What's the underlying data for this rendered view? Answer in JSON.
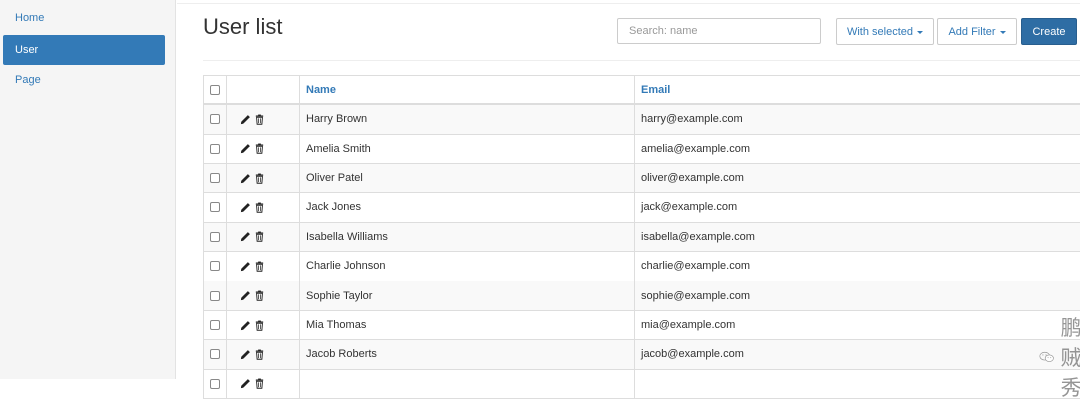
{
  "sidebar": {
    "items": [
      {
        "label": "Home",
        "active": false
      },
      {
        "label": "User",
        "active": true
      },
      {
        "label": "Page",
        "active": false
      }
    ]
  },
  "header": {
    "title": "User list",
    "search_placeholder": "Search: name",
    "with_selected_label": "With selected",
    "add_filter_label": "Add Filter",
    "create_label": "Create"
  },
  "table": {
    "columns": [
      "Name",
      "Email"
    ],
    "rows": [
      {
        "name": "Harry Brown",
        "email": "harry@example.com"
      },
      {
        "name": "Amelia Smith",
        "email": "amelia@example.com"
      },
      {
        "name": "Oliver Patel",
        "email": "oliver@example.com"
      },
      {
        "name": "Jack Jones",
        "email": "jack@example.com"
      },
      {
        "name": "Isabella Williams",
        "email": "isabella@example.com"
      },
      {
        "name": "Charlie Johnson",
        "email": "charlie@example.com"
      },
      {
        "name": "Sophie Taylor",
        "email": "sophie@example.com"
      },
      {
        "name": "Mia Thomas",
        "email": "mia@example.com"
      },
      {
        "name": "Jacob Roberts",
        "email": "jacob@example.com"
      }
    ]
  },
  "watermark": {
    "text": "鹏哥贼优秀",
    "icon": "wechat-icon"
  },
  "colors": {
    "accent": "#337ab7",
    "primary_button": "#2e6da4",
    "sidebar_bg": "#f5f5f5"
  }
}
